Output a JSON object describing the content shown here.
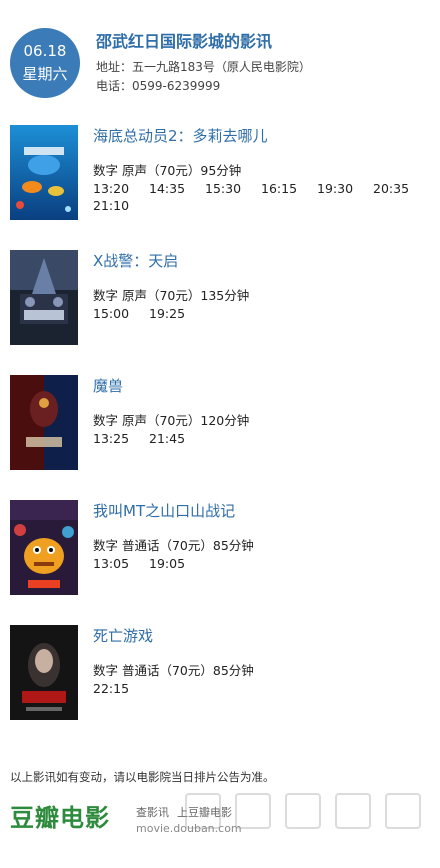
{
  "header": {
    "date": "06.18",
    "weekday": "星期六",
    "cinema_name": "邵武红日国际影城的影讯",
    "address": "地址：五一九路183号（原人民电影院）",
    "phone": "电话：0599-6239999"
  },
  "movies": [
    {
      "title": "海底总动员2：多莉去哪儿",
      "info": "数字  原声（70元）95分钟",
      "times": [
        "13:20",
        "14:35",
        "15:30",
        "16:15",
        "19:30",
        "20:35",
        "21:10"
      ]
    },
    {
      "title": "X战警：天启",
      "info": "数字  原声（70元）135分钟",
      "times": [
        "15:00",
        "19:25"
      ]
    },
    {
      "title": "魔兽",
      "info": "数字  原声（70元）120分钟",
      "times": [
        "13:25",
        "21:45"
      ]
    },
    {
      "title": "我叫MT之山口山战记",
      "info": "数字  普通话（70元）85分钟",
      "times": [
        "13:05",
        "19:05"
      ]
    },
    {
      "title": "死亡游戏",
      "info": "数字  普通话（70元）85分钟",
      "times": [
        "22:15"
      ]
    }
  ],
  "footer": {
    "notice": "以上影讯如有变动，请以电影院当日排片公告为准。",
    "logo": "豆瓣电影",
    "link_showtimes": "查影讯",
    "link_douban": "上豆瓣电影",
    "url": "movie.douban.com"
  },
  "colors": {
    "accent": "#3a7bb8",
    "title": "#2f6ea8",
    "douban_green": "#2e8b3d"
  }
}
